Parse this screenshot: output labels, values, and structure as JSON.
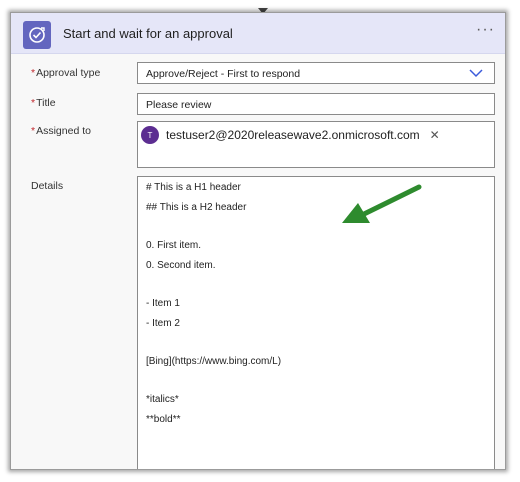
{
  "header": {
    "title": "Start and wait for an approval",
    "menu": "···",
    "icon": "approval-icon",
    "accent": "#6366bf"
  },
  "fields": {
    "approval_type": {
      "label": "Approval type",
      "required_marker": "*",
      "value": "Approve/Reject - First to respond"
    },
    "title": {
      "label": "Title",
      "required_marker": "*",
      "value": "Please review"
    },
    "assigned_to": {
      "label": "Assigned to",
      "required_marker": "*",
      "avatar_initial": "T",
      "value": "testuser2@2020releasewave2.onmicrosoft.com",
      "remove": "✕"
    },
    "details": {
      "label": "Details",
      "lines": [
        "# This is a H1 header",
        "## This is a H2 header",
        "",
        "0. First item.",
        "0. Second item.",
        "",
        "- Item 1",
        "- Item 2",
        "",
        "[Bing](https://www.bing.com/L)",
        "",
        "*italics*",
        "**bold**"
      ]
    }
  },
  "annotation": {
    "icon": "arrow-icon",
    "color": "#2e8b2e"
  }
}
